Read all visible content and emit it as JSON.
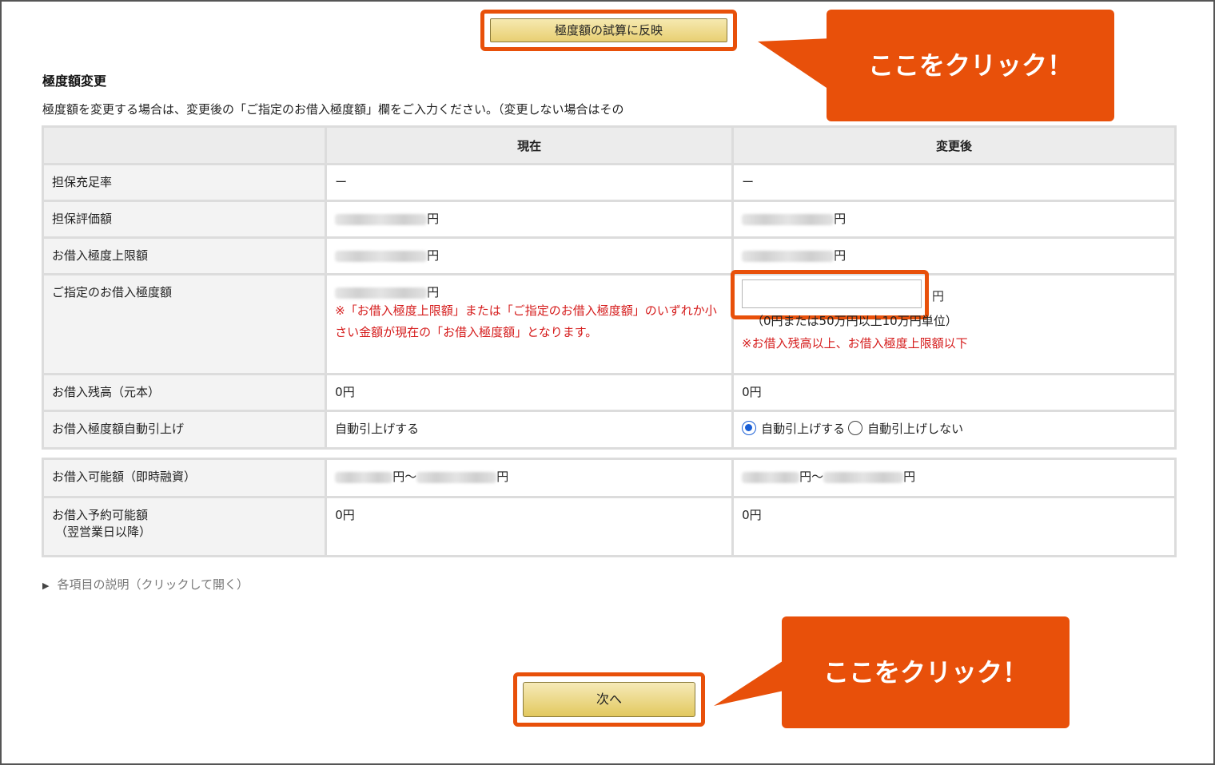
{
  "reflect_button": {
    "label": "極度額の試算に反映"
  },
  "callouts": [
    {
      "text": "ここをクリック！"
    },
    {
      "text": "ここをクリック！"
    }
  ],
  "section": {
    "title": "極度額変更",
    "description": "極度額を変更する場合は、変更後の「ご指定のお借入極度額」欄をご入力ください。（変更しない場合はその"
  },
  "table": {
    "headers": [
      "",
      "現在",
      "変更後"
    ],
    "rows": {
      "collateral_ratio": {
        "label": "担保充足率",
        "current": "ー",
        "after": "ー"
      },
      "collateral_value": {
        "label": "担保評価額",
        "current_unit": "円",
        "after_unit": "円"
      },
      "upper_limit": {
        "label": "お借入極度上限額",
        "current_unit": "円",
        "after_unit": "円"
      },
      "designated_limit": {
        "label": "ご指定のお借入極度額",
        "current_unit": "円",
        "current_note": "※「お借入極度上限額」または「ご指定のお借入極度額」のいずれか小さい金額が現在の「お借入極度額」となります。",
        "input_value": "",
        "after_unit": "円",
        "after_hint": "（0円または50万円以上10万円単位）",
        "after_note": "※お借入残高以上、お借入極度上限額以下"
      },
      "balance": {
        "label": "お借入残高（元本）",
        "current": "0円",
        "after": "0円"
      },
      "auto_raise": {
        "label": "お借入極度額自動引上げ",
        "current": "自動引上げする",
        "option_yes": "自動引上げする",
        "option_no": "自動引上げしない",
        "selected": "yes"
      }
    }
  },
  "table2": {
    "rows": {
      "available": {
        "label": "お借入可能額（即時融資）",
        "current_mid": "円～",
        "current_end": "円",
        "after_mid": "円～",
        "after_end": "円"
      },
      "reserve": {
        "label_line1": "お借入予約可能額",
        "label_line2": "（翌営業日以降）",
        "current": "0円",
        "after": "0円"
      }
    }
  },
  "disclosure": {
    "label": "各項目の説明（クリックして開く）"
  },
  "next_button": {
    "label": "次へ"
  },
  "colors": {
    "accent_orange": "#e8500a",
    "note_red": "#d51c1c",
    "button_gold": "#e8cf72",
    "radio_blue": "#1a5fd6"
  },
  "icons": {
    "disclosure": "triangle-right-icon"
  }
}
